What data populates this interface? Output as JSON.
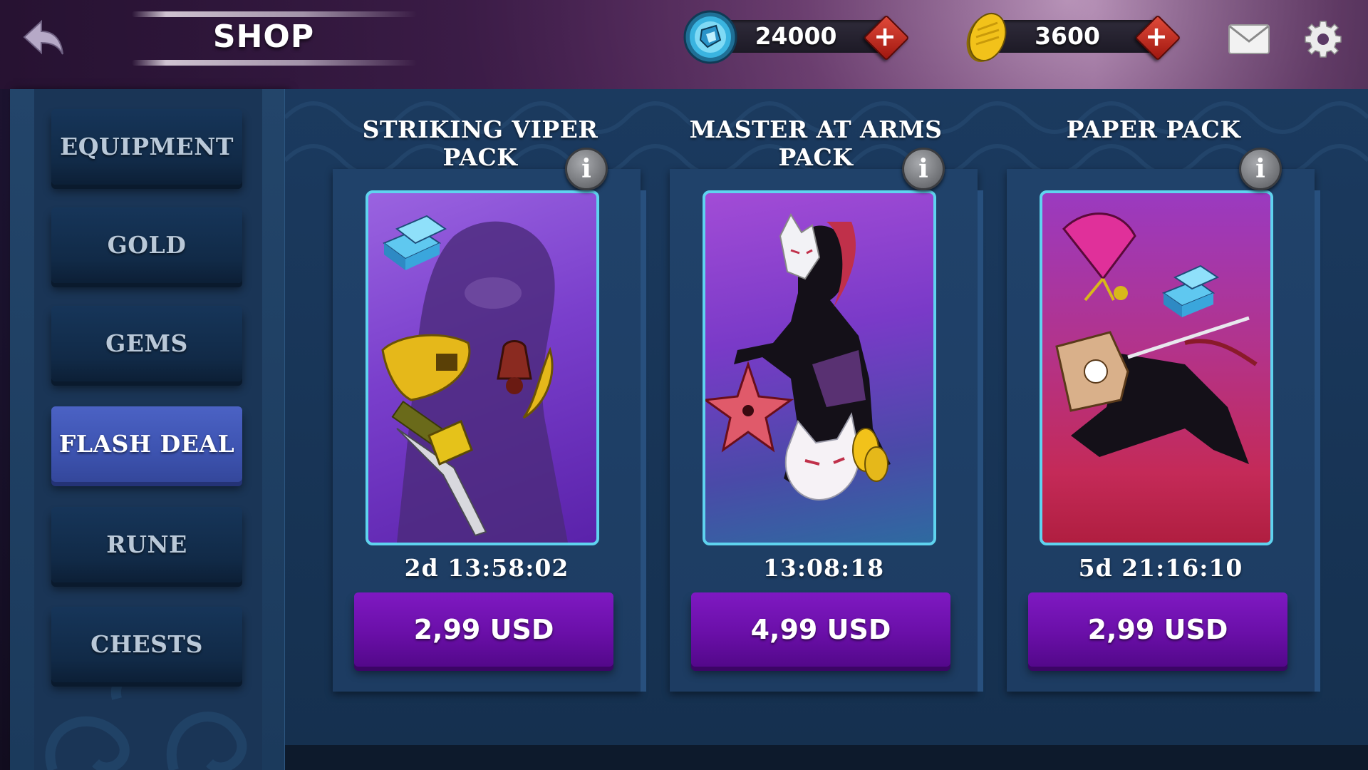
{
  "header": {
    "title": "SHOP",
    "gems": {
      "value": "24000",
      "plus_label": "+"
    },
    "gold": {
      "value": "3600",
      "plus_label": "+"
    }
  },
  "sidebar": {
    "items": [
      {
        "label": "EQUIPMENT",
        "active": false
      },
      {
        "label": "GOLD",
        "active": false
      },
      {
        "label": "GEMS",
        "active": false
      },
      {
        "label": "FLASH DEAL",
        "active": true
      },
      {
        "label": "RUNE",
        "active": false
      },
      {
        "label": "CHESTS",
        "active": false
      }
    ]
  },
  "packs": [
    {
      "title": "STRIKING VIPER PACK",
      "timer": "2d 13:58:02",
      "price": "2,99 USD",
      "info": "i"
    },
    {
      "title": "MASTER AT ARMS PACK",
      "timer": "13:08:18",
      "price": "4,99 USD",
      "info": "i"
    },
    {
      "title": "PAPER PACK",
      "timer": "5d 21:16:10",
      "price": "2,99 USD",
      "info": "i"
    }
  ],
  "colors": {
    "sidebar_bg": "#1b3a5c",
    "active_tab": "#3d53b0",
    "buy_button": "#6a0fa8",
    "card_border": "#5fd3ef",
    "plus_button": "#c02a1e"
  },
  "icons": [
    "back-arrow-icon",
    "gem-currency-icon",
    "gold-coin-icon",
    "plus-icon",
    "mail-icon",
    "gear-icon",
    "info-icon"
  ]
}
